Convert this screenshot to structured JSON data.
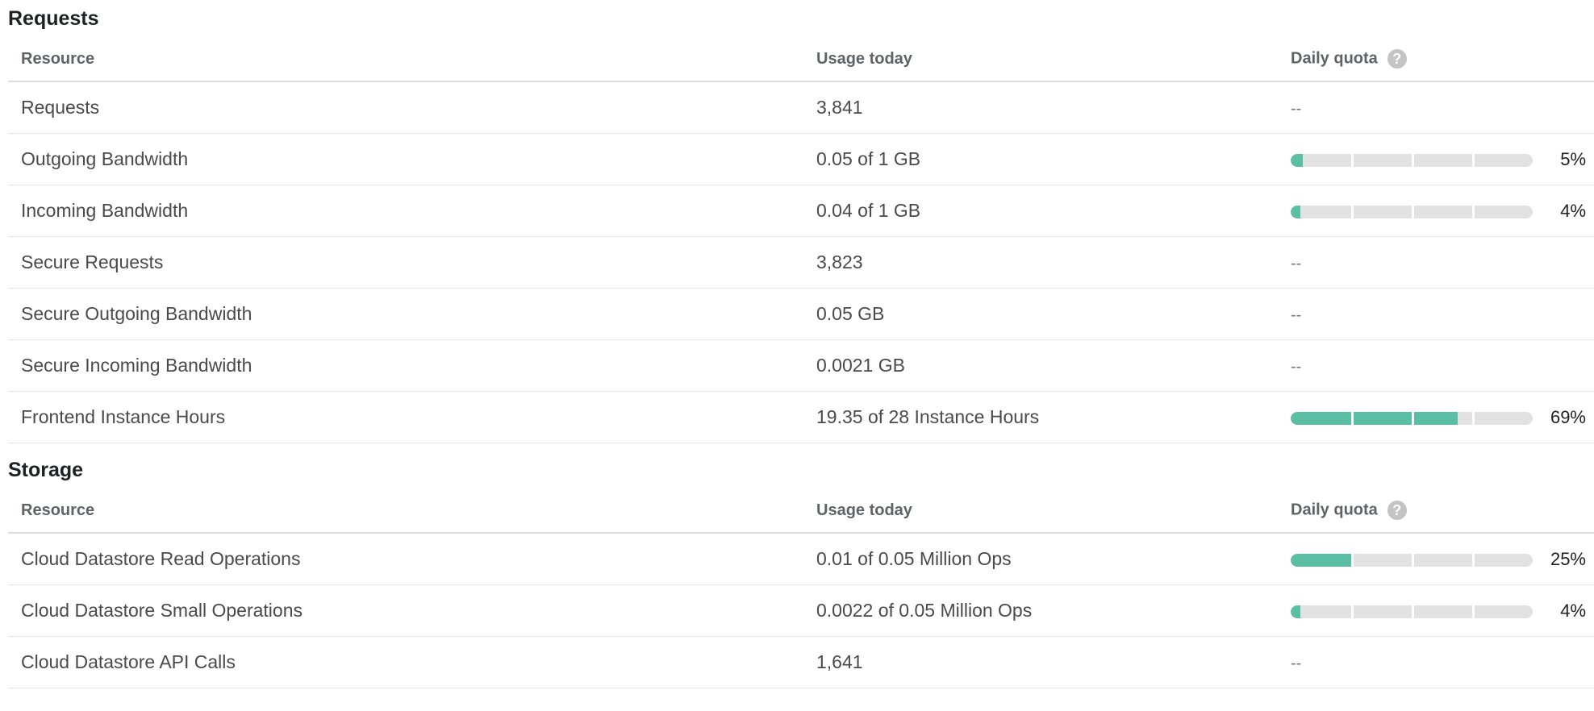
{
  "requests": {
    "title": "Requests",
    "headers": {
      "resource": "Resource",
      "usage": "Usage today",
      "quota": "Daily quota"
    },
    "help_icon_glyph": "?",
    "rows": [
      {
        "resource": "Requests",
        "usage": "3,841",
        "quota_text": "--",
        "percent": null
      },
      {
        "resource": "Outgoing Bandwidth",
        "usage": "0.05 of 1 GB",
        "quota_text": "5%",
        "percent": 5
      },
      {
        "resource": "Incoming Bandwidth",
        "usage": "0.04 of 1 GB",
        "quota_text": "4%",
        "percent": 4
      },
      {
        "resource": "Secure Requests",
        "usage": "3,823",
        "quota_text": "--",
        "percent": null
      },
      {
        "resource": "Secure Outgoing Bandwidth",
        "usage": "0.05 GB",
        "quota_text": "--",
        "percent": null
      },
      {
        "resource": "Secure Incoming Bandwidth",
        "usage": "0.0021 GB",
        "quota_text": "--",
        "percent": null
      },
      {
        "resource": "Frontend Instance Hours",
        "usage": "19.35 of 28 Instance Hours",
        "quota_text": "69%",
        "percent": 69
      }
    ]
  },
  "storage": {
    "title": "Storage",
    "headers": {
      "resource": "Resource",
      "usage": "Usage today",
      "quota": "Daily quota"
    },
    "help_icon_glyph": "?",
    "rows": [
      {
        "resource": "Cloud Datastore Read Operations",
        "usage": "0.01 of 0.05 Million Ops",
        "quota_text": "25%",
        "percent": 25
      },
      {
        "resource": "Cloud Datastore Small Operations",
        "usage": "0.0022 of 0.05 Million Ops",
        "quota_text": "4%",
        "percent": 4
      },
      {
        "resource": "Cloud Datastore API Calls",
        "usage": "1,641",
        "quota_text": "--",
        "percent": null
      }
    ]
  },
  "colors": {
    "bar_fill": "#5bbfa6",
    "bar_track": "#e2e2e2",
    "help_icon": "#c4c4c4"
  }
}
